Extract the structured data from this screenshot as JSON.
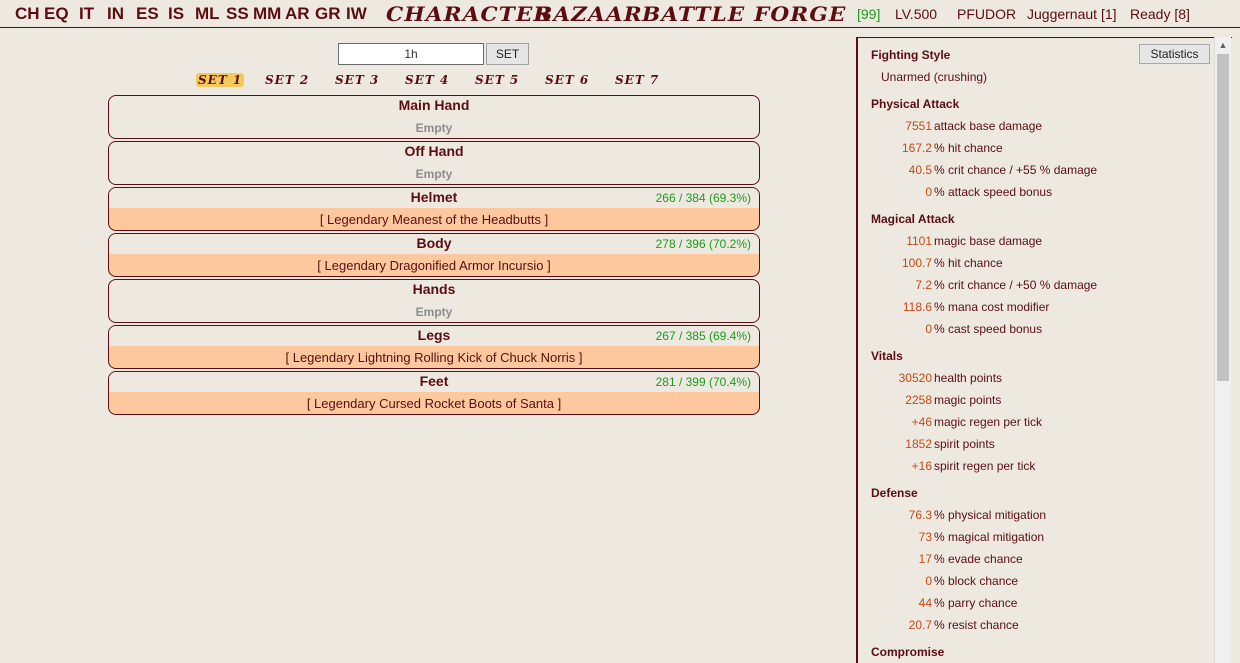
{
  "nav": {
    "abbr": [
      "CH",
      "EQ",
      "IT",
      "IN",
      "ES",
      "IS",
      "ML",
      "SS",
      "MM",
      "AR",
      "GR",
      "IW"
    ],
    "big": [
      "CHARACTER",
      "BAZAAR",
      "BATTLE",
      "FORGE"
    ],
    "count": "[99]",
    "level": "LV.500",
    "persona": "PFUDOR",
    "persona_slot": "Juggernaut [1]",
    "ready": "Ready [8]"
  },
  "equip": {
    "input_value": "1h",
    "set_button": "SET",
    "tabs": [
      "SET 1",
      "SET 2",
      "SET 3",
      "SET 4",
      "SET 5",
      "SET 6",
      "SET 7"
    ],
    "active_tab_index": 0,
    "empty_label": "Empty",
    "slots": [
      {
        "name": "Main Hand",
        "durability": "",
        "item": ""
      },
      {
        "name": "Off Hand",
        "durability": "",
        "item": ""
      },
      {
        "name": "Helmet",
        "durability": "266 / 384 (69.3%)",
        "item": "[ Legendary Meanest of the Headbutts ]"
      },
      {
        "name": "Body",
        "durability": "278 / 396 (70.2%)",
        "item": "[ Legendary Dragonified Armor Incursio ]"
      },
      {
        "name": "Hands",
        "durability": "",
        "item": ""
      },
      {
        "name": "Legs",
        "durability": "267 / 385 (69.4%)",
        "item": "[ Legendary Lightning Rolling Kick of Chuck Norris ]"
      },
      {
        "name": "Feet",
        "durability": "281 / 399 (70.4%)",
        "item": "[ Legendary Cursed Rocket Boots of Santa ]"
      }
    ]
  },
  "stats": {
    "button": "Statistics",
    "fighting_style_title": "Fighting Style",
    "fighting_style": "Unarmed (crushing)",
    "sections": [
      {
        "title": "Physical Attack",
        "rows": [
          {
            "value": "7551",
            "label": "attack base damage"
          },
          {
            "value": "167.2",
            "label": "% hit chance"
          },
          {
            "value": "40.5",
            "label": "% crit chance / +55 % damage"
          },
          {
            "value": "0",
            "label": "% attack speed bonus"
          }
        ]
      },
      {
        "title": "Magical Attack",
        "rows": [
          {
            "value": "1101",
            "label": "magic base damage"
          },
          {
            "value": "100.7",
            "label": "% hit chance"
          },
          {
            "value": "7.2",
            "label": "% crit chance / +50 % damage"
          },
          {
            "value": "118.6",
            "label": "% mana cost modifier"
          },
          {
            "value": "0",
            "label": "% cast speed bonus"
          }
        ]
      },
      {
        "title": "Vitals",
        "rows": [
          {
            "value": "30520",
            "label": "health points"
          },
          {
            "value": "2258",
            "label": "magic points"
          },
          {
            "value": "+46",
            "label": "magic regen per tick"
          },
          {
            "value": "1852",
            "label": "spirit points"
          },
          {
            "value": "+16",
            "label": "spirit regen per tick"
          }
        ]
      },
      {
        "title": "Defense",
        "rows": [
          {
            "value": "76.3",
            "label": "% physical mitigation"
          },
          {
            "value": "73",
            "label": "% magical mitigation"
          },
          {
            "value": "17",
            "label": "% evade chance"
          },
          {
            "value": "0",
            "label": "% block chance"
          },
          {
            "value": "44",
            "label": "% parry chance"
          },
          {
            "value": "20.7",
            "label": "% resist chance"
          }
        ]
      },
      {
        "title": "Compromise",
        "rows": []
      }
    ]
  },
  "colors": {
    "maroon": "#5c0d11",
    "value_orange": "#c44a16",
    "green": "#1e9a1e",
    "item_peach": "#fdc89d",
    "background": "#ede9e0",
    "tab_highlight": "#f4c95c"
  }
}
